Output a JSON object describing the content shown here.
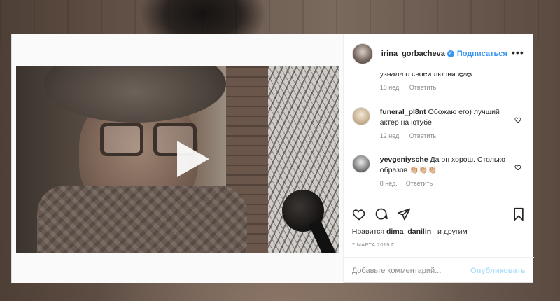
{
  "post": {
    "username": "irina_gorbacheva",
    "follow_label": "Подписаться",
    "more_label": "•••"
  },
  "comments": [
    {
      "username": "",
      "text": "узнала о своей любви 😅😅",
      "age": "18 нед.",
      "reply_label": "Ответить"
    },
    {
      "username": "funeral_pl8nt",
      "text": "Обожаю его) лучший актер на ютубе",
      "age": "12 нед.",
      "reply_label": "Ответить"
    },
    {
      "username": "yevgeniysche",
      "text": "Да он хорош. Столько образов 👏🏼👏🏼👏🏼",
      "age": "8 нед.",
      "reply_label": "Ответить"
    }
  ],
  "likes": {
    "prefix": "Нравится",
    "user": "dima_danilin_",
    "suffix": "и другим"
  },
  "date": "7 марта 2019 г.",
  "add_comment": {
    "placeholder": "Добавьте комментарий...",
    "publish_label": "Опубликовать"
  },
  "colors": {
    "accent": "#3897f0",
    "publish_disabled": "#b2dffc",
    "meta_text": "#8e8e8e"
  },
  "icons": {
    "heart": "heart-icon",
    "comment": "comment-icon",
    "share": "share-icon",
    "bookmark": "bookmark-icon",
    "play": "play-icon"
  }
}
